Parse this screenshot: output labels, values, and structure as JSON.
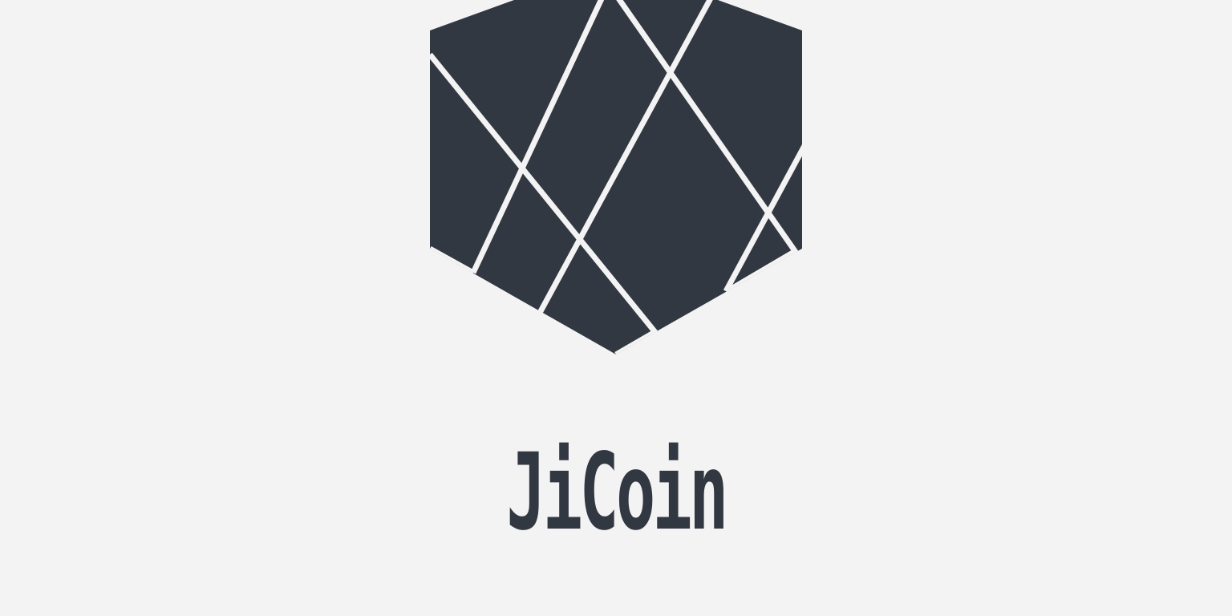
{
  "brand": {
    "name": "JiCoin",
    "tagline": "",
    "logo_icon": "faceted-hexagon-gem-icon"
  },
  "colors": {
    "background": "#f3f3f3",
    "primary": "#323842",
    "secondary": "#5b6068"
  }
}
